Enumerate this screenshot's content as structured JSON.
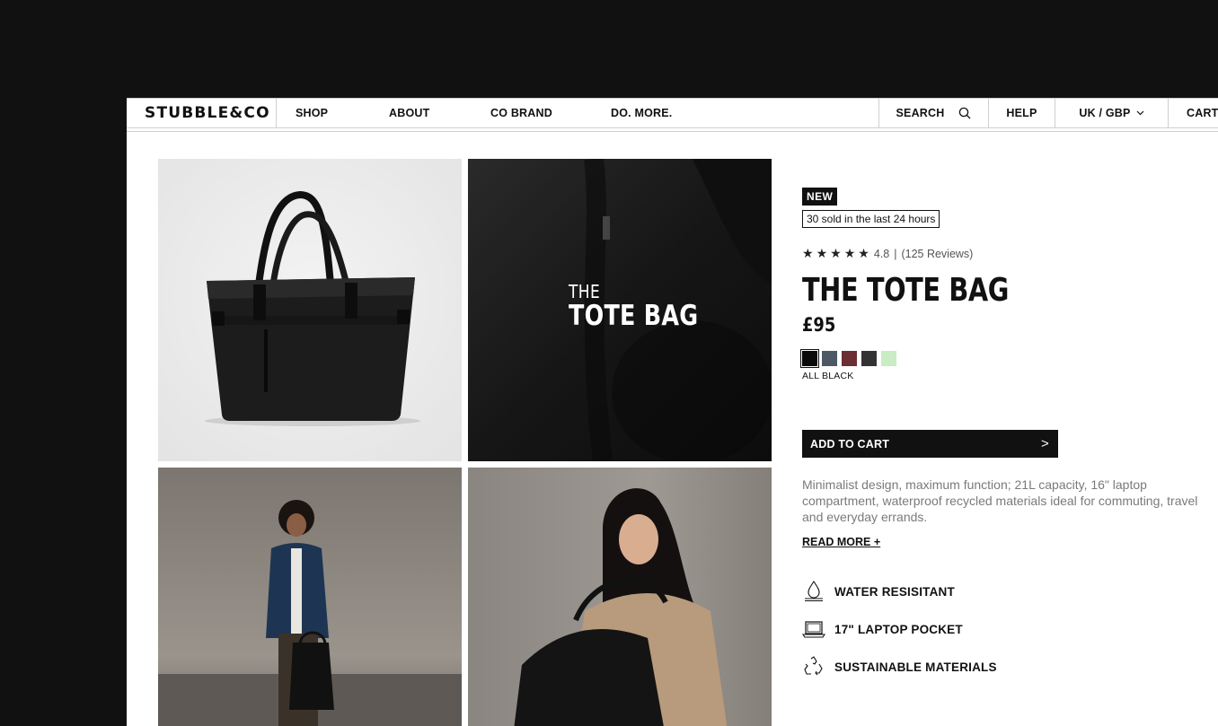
{
  "nav": {
    "logo": "STUBBLE&CO",
    "items": [
      "SHOP",
      "ABOUT",
      "CO BRAND",
      "DO. MORE."
    ],
    "search_label": "SEARCH",
    "help_label": "HELP",
    "region_label": "UK / GBP",
    "cart_label": "CART"
  },
  "gallery": {
    "overlay_small": "THE",
    "overlay_big": "TOTE BAG"
  },
  "product": {
    "badge": "NEW",
    "sold_text": "30 sold in the last 24 hours",
    "rating_value": "4.8",
    "rating_separator": "|",
    "reviews": "(125 Reviews)",
    "stars": 5,
    "title": "THE TOTE BAG",
    "price": "£95",
    "swatches": [
      "#0b0b0b",
      "#4f5966",
      "#6a2e33",
      "#333333",
      "#c9ecc5"
    ],
    "selected_swatch_label": "ALL BLACK",
    "add_to_cart": "ADD TO CART",
    "add_to_cart_arrow": ">",
    "description": "Minimalist design, maximum function; 21L capacity, 16\" laptop compartment, waterproof recycled materials ideal for commuting, travel and everyday errands.",
    "read_more": "READ MORE +",
    "features": [
      {
        "icon": "water-drop-icon",
        "label": "WATER RESISITANT"
      },
      {
        "icon": "laptop-icon",
        "label": "17\" LAPTOP POCKET"
      },
      {
        "icon": "recycle-icon",
        "label": "SUSTAINABLE MATERIALS"
      }
    ]
  }
}
